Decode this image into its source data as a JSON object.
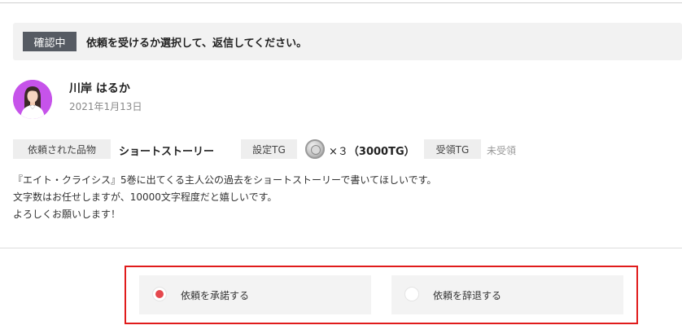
{
  "status": {
    "badge": "確認中",
    "message": "依頼を受けるか選択して、返信してください。"
  },
  "user": {
    "name": "川岸 はるか",
    "date": "2021年1月13日"
  },
  "meta": {
    "requested_item_label": "依頼された品物",
    "requested_item_value": "ショートストーリー",
    "set_tg_label": "設定TG",
    "tg_multiplier": "×３",
    "tg_total": "（3000TG）",
    "received_tg_label": "受領TG",
    "received_tg_value": "未受領"
  },
  "description": [
    "『エイト・クライシス』5巻に出てくる主人公の過去をショートストーリーで書いてほしいです。",
    "文字数はお任せしますが、10000文字程度だと嬉しいです。",
    "よろしくお願いします！"
  ],
  "choices": {
    "accept_label": "依頼を承諾する",
    "decline_label": "依頼を辞退する",
    "selected": "accept"
  },
  "colors": {
    "badge_bg": "#565b63",
    "avatar_bg": "#c653ea",
    "radio_selected": "#e5484d",
    "highlight_border": "#e01b1b"
  }
}
